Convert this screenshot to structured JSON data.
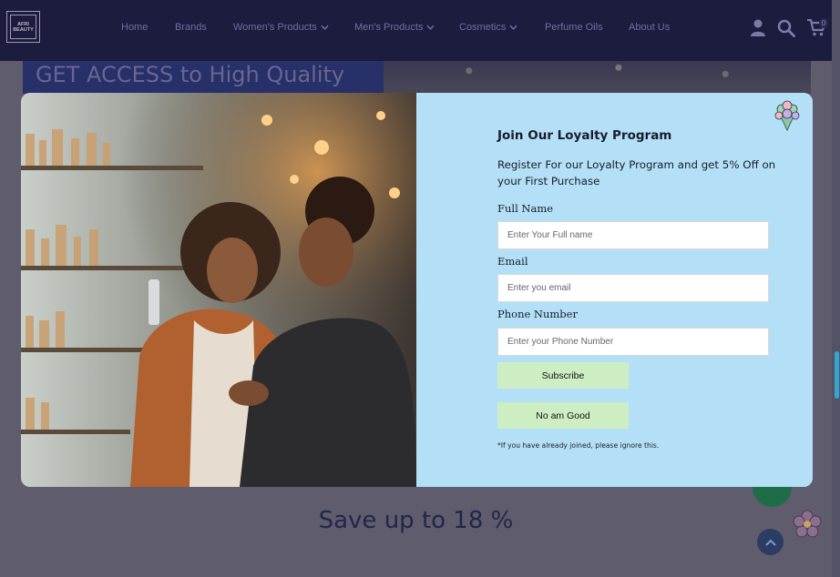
{
  "header": {
    "logo_text": "AFRI BEAUTY",
    "nav": [
      {
        "label": "Home",
        "has_dropdown": false
      },
      {
        "label": "Brands",
        "has_dropdown": false
      },
      {
        "label": "Women's Products",
        "has_dropdown": true
      },
      {
        "label": "Men's Products",
        "has_dropdown": true
      },
      {
        "label": "Cosmetics",
        "has_dropdown": true
      },
      {
        "label": "Perfume Oils",
        "has_dropdown": false
      },
      {
        "label": "About Us",
        "has_dropdown": false
      }
    ],
    "icons": [
      "user-icon",
      "search-icon",
      "cart-icon"
    ],
    "cart_count": "0"
  },
  "banner": {
    "title": "GET ACCESS to High Quality"
  },
  "promo": {
    "text": "Save up to 18 %"
  },
  "modal": {
    "title": "Join Our Loyalty Program",
    "subtitle": "Register For our Loyalty Program and get 5% Off on your First Purchase",
    "fields": {
      "full_name": {
        "label": "Full Name",
        "placeholder": "Enter Your Full name",
        "value": ""
      },
      "email": {
        "label": "Email",
        "placeholder": "Enter you email",
        "value": ""
      },
      "phone": {
        "label": "Phone Number",
        "placeholder": "Enter your Phone Number",
        "value": ""
      }
    },
    "subscribe_label": "Subscribe",
    "decline_label": "No am Good",
    "note": "*If you have already joined, please ignore this."
  },
  "colors": {
    "header_bg": "#1c1c3f",
    "modal_bg": "#b3e0f6",
    "button_bg": "#cdeec3",
    "overlay": "#5e5c6d",
    "scroll_accent": "#37a3cf"
  }
}
